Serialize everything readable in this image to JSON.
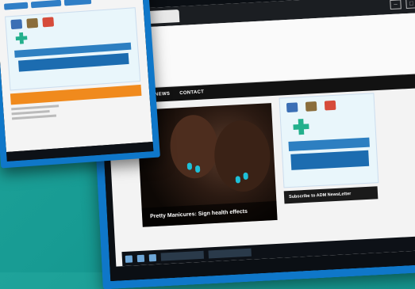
{
  "back_screen": {
    "nav_items": [
      "",
      "NEWS",
      "CONTACT"
    ],
    "hero_caption": "Pretty Manicures: Sign health effects",
    "subscribe_label": "Subscribe to ADM NewsLetter",
    "ad": {
      "title": "",
      "date_text": "",
      "url_text": ""
    },
    "taskbar_time": ""
  },
  "front_screen": {
    "nav_pills": [
      "",
      "",
      ""
    ],
    "orange_bar_label": "",
    "taskbar_time": ""
  },
  "colors": {
    "background": "#179b93",
    "monitor_frame": "#0f77c9",
    "nav_bar": "#121212",
    "ad_banner": "#2d7fc1",
    "orange_bar": "#f08a1d"
  },
  "icons": [
    "window-minimize-icon",
    "window-maximize-icon",
    "window-close-icon",
    "windows-start-icon"
  ]
}
